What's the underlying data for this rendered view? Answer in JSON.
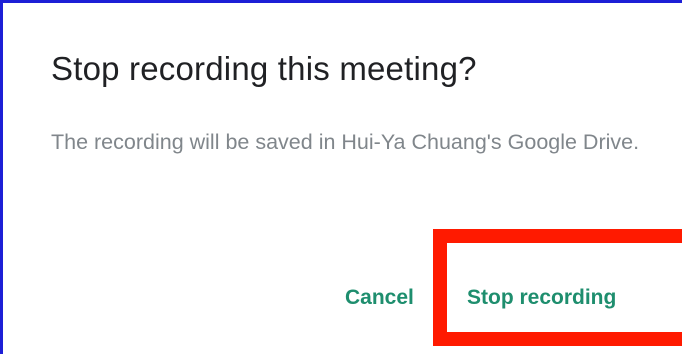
{
  "dialog": {
    "title": "Stop recording this meeting?",
    "message": "The recording will be saved in Hui-Ya Chuang's Google Drive.",
    "cancel_label": "Cancel",
    "confirm_label": "Stop recording"
  },
  "colors": {
    "accent": "#1e8e6e",
    "title_text": "#202124",
    "body_text": "#80868b",
    "highlight_box": "#ff1a00",
    "frame_border": "#1d1fd6"
  }
}
